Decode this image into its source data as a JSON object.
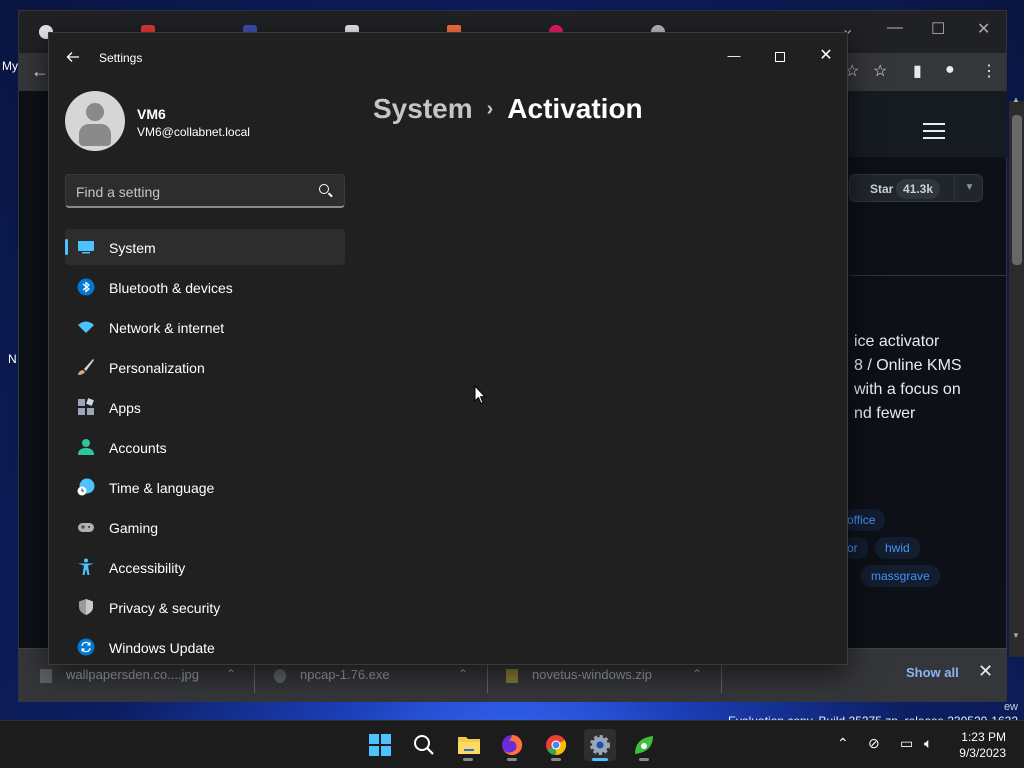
{
  "desktop": {
    "left_labels": [
      "My",
      "N"
    ],
    "watermark_line1": "ew",
    "watermark_line2": "Evaluation copy. Build 25375.zn_release.230520-1632"
  },
  "browser": {
    "star_label": "Star",
    "star_count": "41.3k",
    "description_lines": [
      "ice activator",
      "8 / Online KMS",
      " with a focus on",
      "nd fewer"
    ],
    "topics": [
      "office",
      "or",
      "hwid",
      "massgrave"
    ]
  },
  "downloads": {
    "items": [
      {
        "name": "wallpapersden.co....jpg"
      },
      {
        "name": "npcap-1.76.exe"
      },
      {
        "name": "novetus-windows.zip"
      }
    ],
    "show_all": "Show all",
    "close_glyph": "✕"
  },
  "settings": {
    "window_title": "Settings",
    "user": {
      "name": "VM6",
      "email": "VM6@collabnet.local"
    },
    "search_placeholder": "Find a setting",
    "nav": [
      {
        "label": "System",
        "icon": "system-icon",
        "color": "#4cc2ff",
        "active": true
      },
      {
        "label": "Bluetooth & devices",
        "icon": "bluetooth-icon",
        "color": "#0078d4"
      },
      {
        "label": "Network & internet",
        "icon": "wifi-icon",
        "color": "#4cc2ff"
      },
      {
        "label": "Personalization",
        "icon": "brush-icon",
        "color": "#e0a870"
      },
      {
        "label": "Apps",
        "icon": "apps-icon",
        "color": "#9aa5b8"
      },
      {
        "label": "Accounts",
        "icon": "accounts-icon",
        "color": "#2fc4a0"
      },
      {
        "label": "Time & language",
        "icon": "globe-clock-icon",
        "color": "#4cc2ff"
      },
      {
        "label": "Gaming",
        "icon": "gamepad-icon",
        "color": "#b0b0b0"
      },
      {
        "label": "Accessibility",
        "icon": "accessibility-icon",
        "color": "#4cc2ff"
      },
      {
        "label": "Privacy & security",
        "icon": "shield-icon",
        "color": "#9a9a9a"
      },
      {
        "label": "Windows Update",
        "icon": "update-icon",
        "color": "#0078d4"
      }
    ],
    "breadcrumb_parent": "System",
    "breadcrumb_separator": "›",
    "breadcrumb_current": "Activation"
  },
  "taskbar": {
    "apps": [
      {
        "name": "start-button",
        "color": "#4cc2ff"
      },
      {
        "name": "search-button",
        "color": "#ffffff"
      },
      {
        "name": "file-explorer",
        "color": "#f7c948"
      },
      {
        "name": "firefox",
        "color": "#ff7139"
      },
      {
        "name": "chrome",
        "color": "#34a853"
      },
      {
        "name": "settings-app",
        "color": "#9aa5b8",
        "active": true
      },
      {
        "name": "green-app",
        "color": "#3fbf3f"
      }
    ],
    "time": "1:23 PM",
    "date": "9/3/2023"
  }
}
